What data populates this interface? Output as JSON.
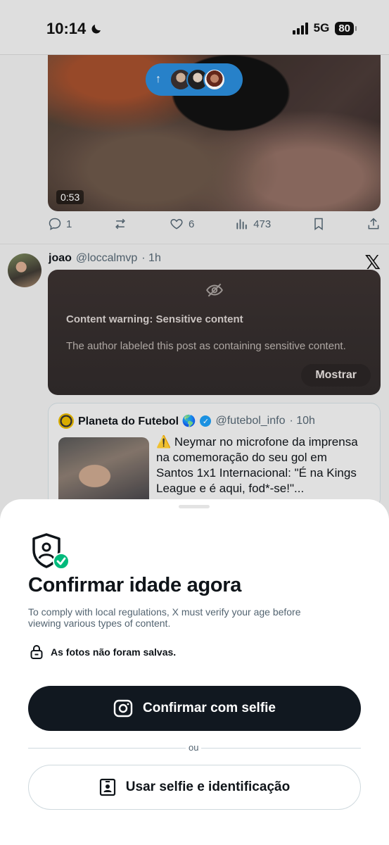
{
  "status_bar": {
    "time": "10:14",
    "network": "5G",
    "battery": "80"
  },
  "video_post": {
    "duration": "0:53",
    "actions": {
      "replies": "1",
      "retweets": "",
      "likes": "6",
      "views": "473"
    }
  },
  "post": {
    "name": "joao",
    "handle": "@loccalmvp",
    "time": "· 1h",
    "warning_title": "Content warning: Sensitive content",
    "warning_body": "The author labeled this post as containing sensitive content.",
    "show_button": "Mostrar",
    "quote": {
      "name": "Planeta do Futebol 🌎",
      "handle": "@futebol_info",
      "time": "· 10h",
      "text": "⚠️ Neymar no microfone da imprensa na comemoração do seu gol em Santos 1x1 Internacional: \"É na Kings League e é aqui, fod*-se!\"..."
    }
  },
  "sheet": {
    "title": "Confirmar idade agora",
    "description": "To comply with local regulations, X must verify your age before viewing various types of content.",
    "note": "As fotos não foram salvas.",
    "primary_button": "Confirmar com selfie",
    "or": "ou",
    "secondary_button": "Usar selfie e identificação"
  },
  "colors": {
    "accent": "#1d9bf0",
    "dark_button": "#111820",
    "check_green": "#00ba7c"
  }
}
